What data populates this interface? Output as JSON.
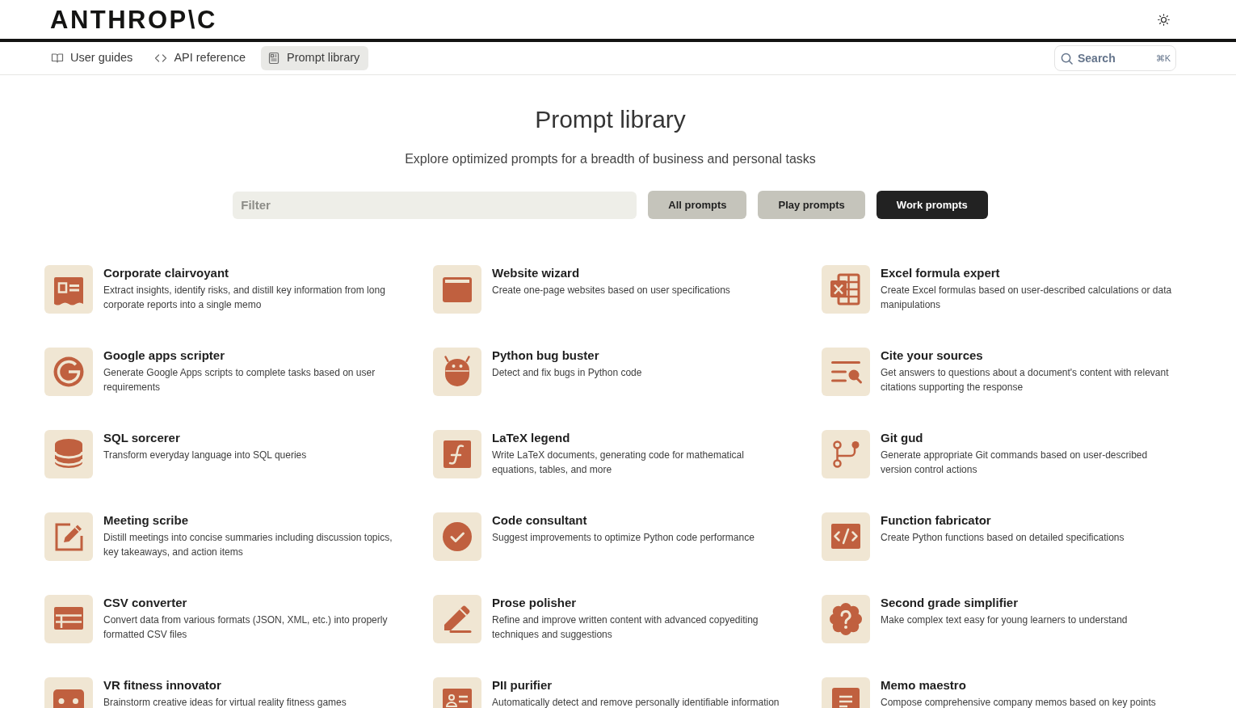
{
  "header": {
    "logo": "ANTHROP\\C"
  },
  "nav": {
    "tabs": [
      {
        "label": "User guides",
        "kind": "book",
        "selected": false
      },
      {
        "label": "API reference",
        "kind": "code",
        "selected": false
      },
      {
        "label": "Prompt library",
        "kind": "document",
        "selected": true
      }
    ],
    "search": {
      "label": "Search",
      "shortcut": "⌘K"
    }
  },
  "page": {
    "title": "Prompt library",
    "subtitle": "Explore optimized prompts for a breadth of business and personal tasks"
  },
  "filter": {
    "placeholder": "Filter"
  },
  "categories": [
    {
      "label": "All prompts",
      "selected": false
    },
    {
      "label": "Play prompts",
      "selected": false
    },
    {
      "label": "Work prompts",
      "selected": true
    }
  ],
  "prompts": [
    {
      "kind": "newspaper",
      "title": "Corporate clairvoyant",
      "description": "Extract insights, identify risks, and distill key information from long corporate reports into a single memo"
    },
    {
      "kind": "browser",
      "title": "Website wizard",
      "description": "Create one-page websites based on user specifications"
    },
    {
      "kind": "spreadsheet",
      "title": "Excel formula expert",
      "description": "Create Excel formulas based on user-described calculations or data manipulations"
    },
    {
      "kind": "letter",
      "title": "Google apps scripter",
      "description": "Generate Google Apps scripts to complete tasks based on user requirements"
    },
    {
      "kind": "robot",
      "title": "Python bug buster",
      "description": "Detect and fix bugs in Python code"
    },
    {
      "kind": "lookup",
      "title": "Cite your sources",
      "description": "Get answers to questions about a document's content with relevant citations supporting the response"
    },
    {
      "kind": "database",
      "title": "SQL sorcerer",
      "description": "Transform everyday language into SQL queries"
    },
    {
      "kind": "function",
      "title": "LaTeX legend",
      "description": "Write LaTeX documents, generating code for mathematical equations, tables, and more"
    },
    {
      "kind": "branch",
      "title": "Git gud",
      "description": "Generate appropriate Git commands based on user-described version control actions"
    },
    {
      "kind": "edit",
      "title": "Meeting scribe",
      "description": "Distill meetings into concise summaries including discussion topics, key takeaways, and action items"
    },
    {
      "kind": "check",
      "title": "Code consultant",
      "description": "Suggest improvements to optimize Python code performance"
    },
    {
      "kind": "code",
      "title": "Function fabricator",
      "description": "Create Python functions based on detailed specifications"
    },
    {
      "kind": "table",
      "title": "CSV converter",
      "description": "Convert data from various formats (JSON, XML, etc.) into properly formatted CSV files"
    },
    {
      "kind": "pencil",
      "title": "Prose polisher",
      "description": "Refine and improve written content with advanced copyediting techniques and suggestions"
    },
    {
      "kind": "question",
      "title": "Second grade simplifier",
      "description": "Make complex text easy for young learners to understand"
    },
    {
      "kind": "goggles",
      "title": "VR fitness innovator",
      "description": "Brainstorm creative ideas for virtual reality fitness games"
    },
    {
      "kind": "contact",
      "title": "PII purifier",
      "description": "Automatically detect and remove personally identifiable information"
    },
    {
      "kind": "memo",
      "title": "Memo maestro",
      "description": "Compose comprehensive company memos based on key points"
    }
  ]
}
